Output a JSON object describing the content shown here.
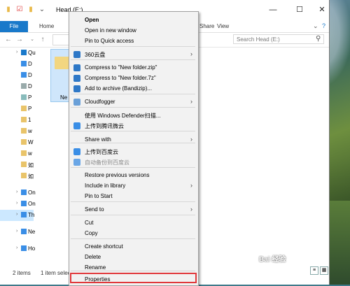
{
  "window": {
    "title": "Head (E:)",
    "controls": {
      "minimize": "—",
      "maximize": "☐",
      "close": "✕"
    }
  },
  "ribbon": {
    "tabs": [
      {
        "label": "File"
      },
      {
        "label": "Home"
      },
      {
        "label": "Share"
      },
      {
        "label": "View"
      }
    ],
    "help_chevron": "⌄",
    "help": "?"
  },
  "address": {
    "back": "←",
    "forward": "→",
    "up": "↑",
    "search_placeholder": "Search Head (E:)"
  },
  "nav_pane": {
    "items": [
      {
        "label": "Qu",
        "icon": "star-icon",
        "color": "#1979ca"
      },
      {
        "label": "D",
        "icon": "desktop-icon",
        "color": "#3a8ee6"
      },
      {
        "label": "D",
        "icon": "download-icon",
        "color": "#3a8ee6"
      },
      {
        "label": "D",
        "icon": "document-icon",
        "color": "#9aa"
      },
      {
        "label": "P",
        "icon": "pictures-icon",
        "color": "#8bb"
      },
      {
        "label": "P",
        "icon": "folder-icon",
        "color": "#e9c46a"
      },
      {
        "label": "1",
        "icon": "folder-icon",
        "color": "#e9c46a"
      },
      {
        "label": "w",
        "icon": "folder-icon",
        "color": "#e9c46a"
      },
      {
        "label": "W",
        "icon": "folder-icon",
        "color": "#e9c46a"
      },
      {
        "label": "w",
        "icon": "folder-icon",
        "color": "#e9c46a"
      },
      {
        "label": "如",
        "icon": "folder-icon",
        "color": "#e9c46a"
      },
      {
        "label": "如",
        "icon": "folder-icon",
        "color": "#e9c46a"
      },
      {
        "label": "On",
        "icon": "onedrive-icon",
        "color": "#3a8ee6"
      },
      {
        "label": "On",
        "icon": "onedrive-icon",
        "color": "#3a8ee6"
      },
      {
        "label": "Th",
        "icon": "this-pc-icon",
        "color": "#3a8ee6"
      },
      {
        "label": "Ne",
        "icon": "network-icon",
        "color": "#3a8ee6"
      },
      {
        "label": "Ho",
        "icon": "homegroup-icon",
        "color": "#3a8ee6"
      }
    ]
  },
  "content": {
    "folder_label": "Ne"
  },
  "status": {
    "count": "2 items",
    "selected": "1 item selec"
  },
  "context_menu": {
    "items": [
      {
        "label": "Open",
        "bold": true
      },
      {
        "label": "Open in new window"
      },
      {
        "label": "Pin to Quick access"
      },
      {
        "label": "360云盘",
        "icon": "360-cloud-icon",
        "color": "#2e78c7",
        "submenu": true
      },
      {
        "label": "Compress to \"New folder.zip\"",
        "icon": "bandizip-icon",
        "color": "#2e78c7"
      },
      {
        "label": "Compress to \"New folder.7z\"",
        "icon": "bandizip-icon",
        "color": "#2e78c7"
      },
      {
        "label": "Add to archive (Bandizip)...",
        "icon": "bandizip-icon",
        "color": "#2e78c7"
      },
      {
        "label": "Cloudfogger",
        "icon": "cloudfogger-icon",
        "color": "#6aa0d8",
        "submenu": true
      },
      {
        "label": "使用 Windows Defender扫描..."
      },
      {
        "label": "上传到腾讯微云",
        "icon": "weiyun-icon",
        "color": "#3a8ee6"
      },
      {
        "label": "Share with",
        "submenu": true
      },
      {
        "label": "上传到百度云",
        "icon": "baidu-cloud-icon",
        "color": "#3a8ee6"
      },
      {
        "label": "自动备份到百度云",
        "icon": "baidu-cloud-icon",
        "color": "#6aa6e6",
        "grey": true
      },
      {
        "label": "Restore previous versions"
      },
      {
        "label": "Include in library",
        "submenu": true
      },
      {
        "label": "Pin to Start"
      },
      {
        "label": "Send to",
        "submenu": true
      },
      {
        "label": "Cut"
      },
      {
        "label": "Copy"
      },
      {
        "label": "Create shortcut"
      },
      {
        "label": "Delete"
      },
      {
        "label": "Rename"
      },
      {
        "label": "Properties"
      }
    ],
    "submenu_arrow": "›"
  },
  "colors": {
    "accent": "#1979ca",
    "highlight_box": "#e0383b"
  }
}
